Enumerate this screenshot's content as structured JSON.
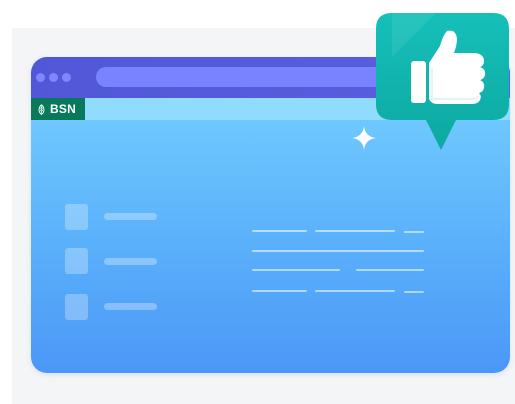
{
  "browser": {
    "brand_label": "BSN",
    "brand_icon": "leaf-icon",
    "colors": {
      "titlebar": "#5158d8",
      "addressbar": "#7a83ff",
      "window_dots": "#7f86ff",
      "tab_strip": "#8fdcff",
      "brand_tab": "#087a5b",
      "page_top": "#79d3ff",
      "page_bottom": "#4b97f7"
    }
  },
  "badge": {
    "icon": "thumbs-up-icon",
    "colors": {
      "bubble": "#10b3ad",
      "thumb": "#ffffff"
    }
  },
  "decorations": {
    "sparkle_icon": "sparkle-icon"
  }
}
